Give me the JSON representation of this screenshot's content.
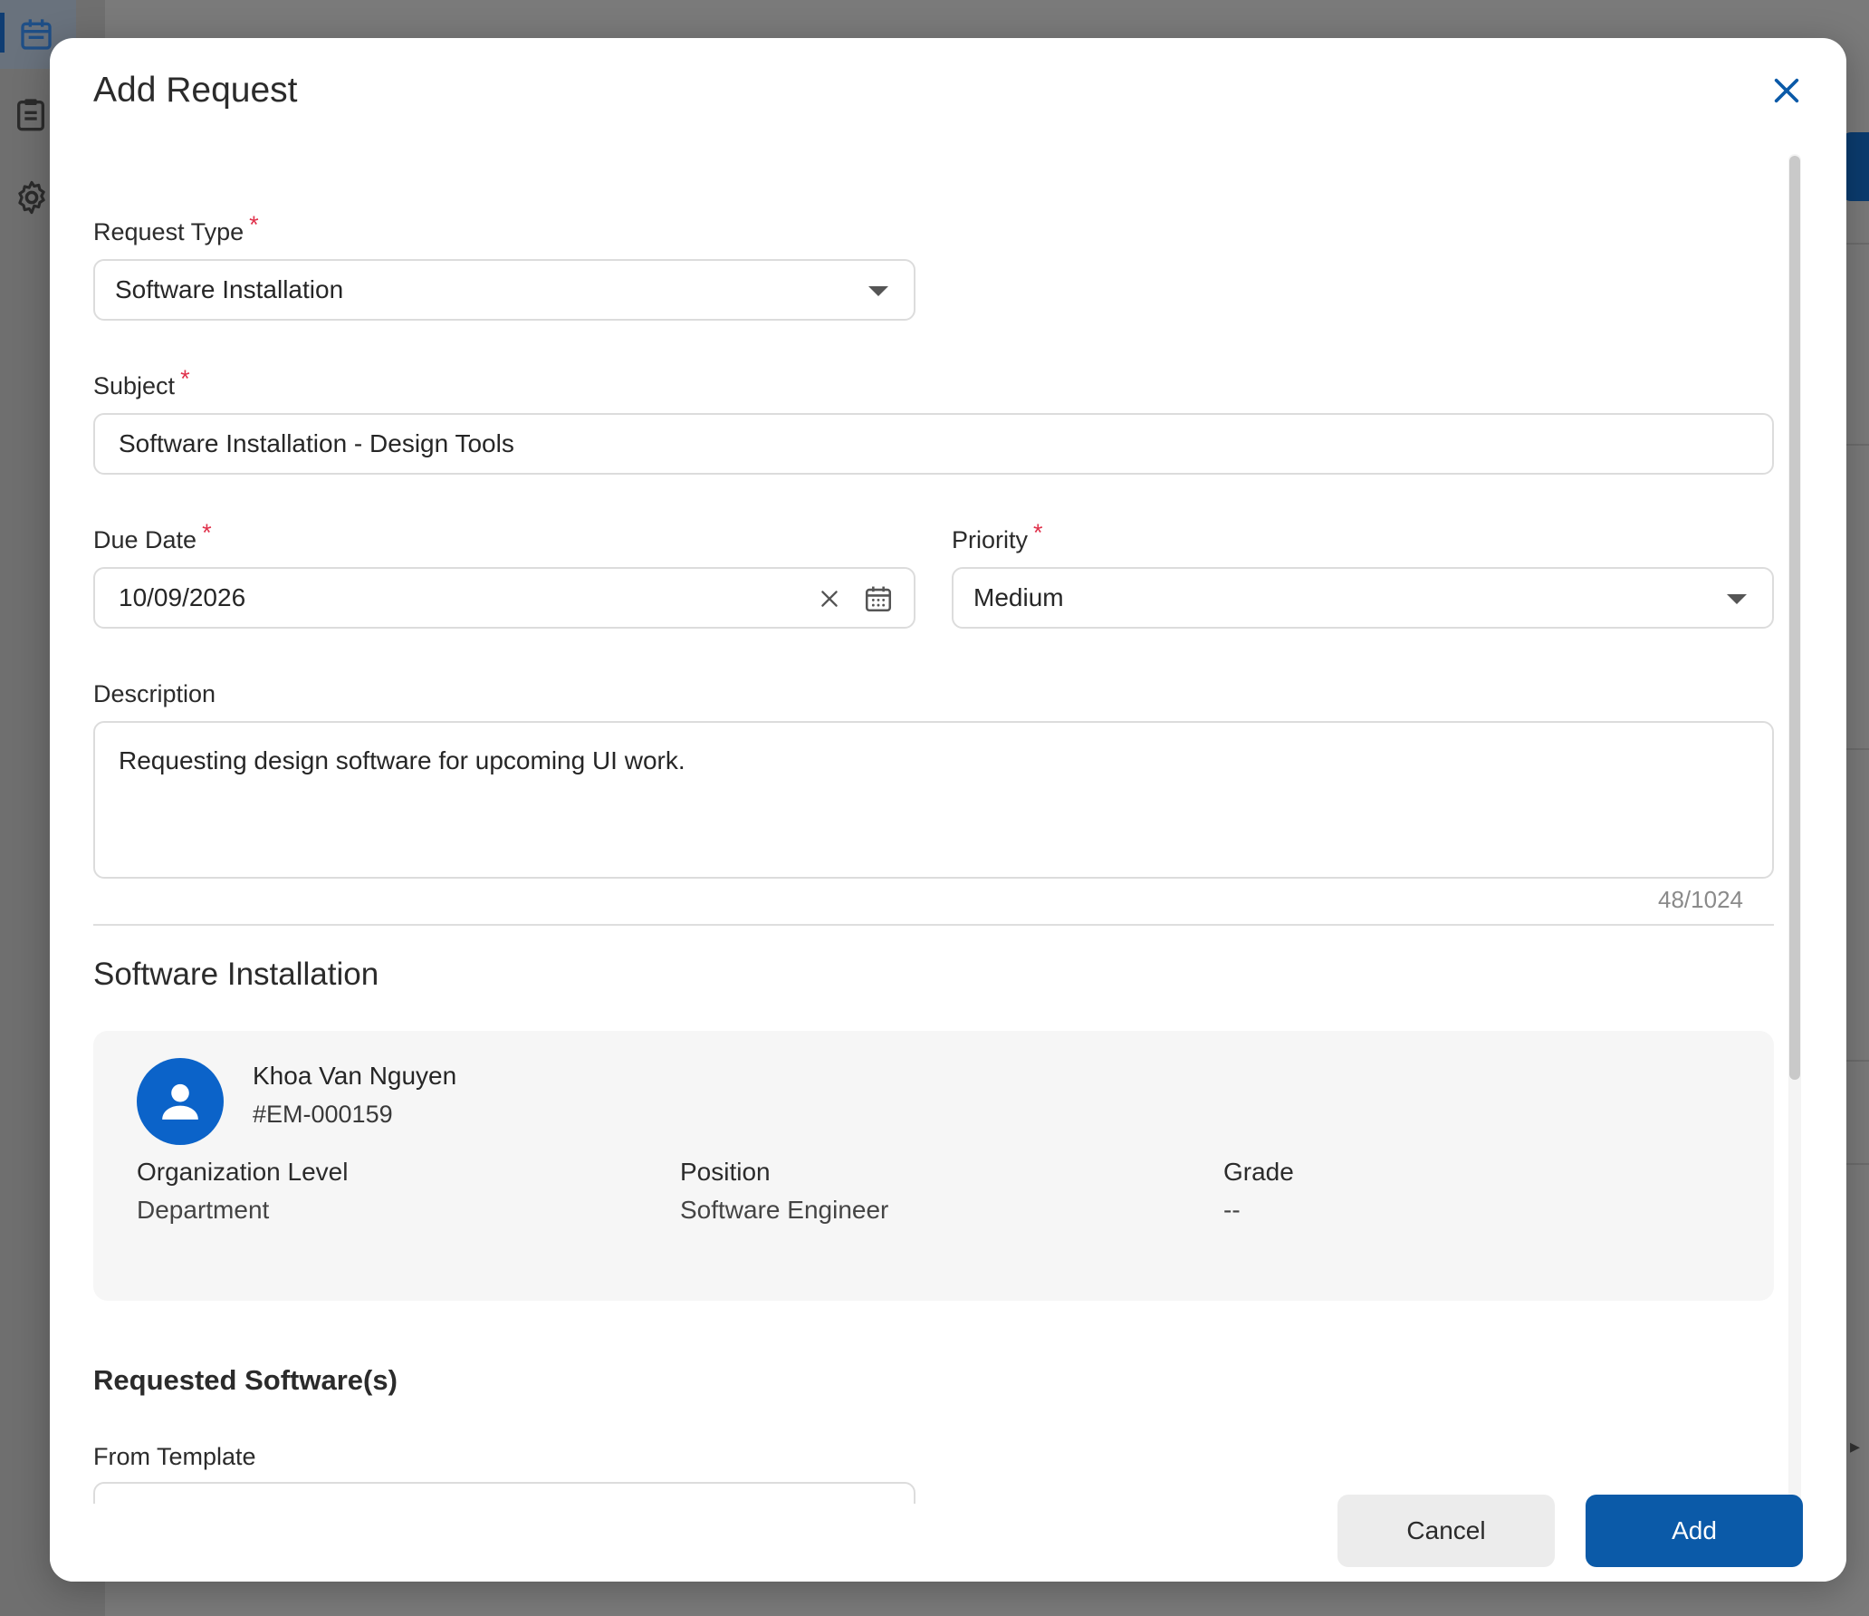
{
  "modal": {
    "title": "Add Request",
    "close_icon": "close-icon"
  },
  "form": {
    "request_type": {
      "label": "Request Type",
      "required": "*",
      "value": "Software Installation"
    },
    "subject": {
      "label": "Subject",
      "required": "*",
      "value": "Software Installation - Design Tools"
    },
    "due_date": {
      "label": "Due Date",
      "required": "*",
      "value": "10/09/2026"
    },
    "priority": {
      "label": "Priority",
      "required": "*",
      "value": "Medium"
    },
    "description": {
      "label": "Description",
      "value": "Requesting design software for upcoming UI work.",
      "char_count": "48/1024"
    }
  },
  "section": {
    "title": "Software Installation",
    "employee": {
      "name": "Khoa Van Nguyen",
      "id": "#EM-000159",
      "fields": [
        {
          "label": "Organization Level",
          "value": "Department"
        },
        {
          "label": "Position",
          "value": "Software Engineer"
        },
        {
          "label": "Grade",
          "value": "--"
        }
      ]
    },
    "requested_software": {
      "title": "Requested Software(s)",
      "from_template_label": "From Template"
    }
  },
  "footer": {
    "cancel_label": "Cancel",
    "add_label": "Add"
  },
  "colors": {
    "primary": "#0b5aa8",
    "required": "#e0314b",
    "avatar": "#0b63c9"
  }
}
